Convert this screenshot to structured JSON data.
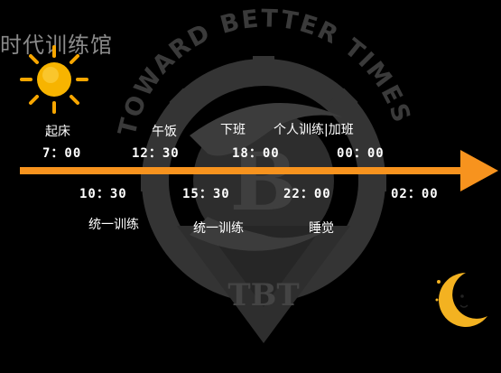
{
  "header": {
    "title": "时代训练馆"
  },
  "logo": {
    "arc_text": "TOWARD BETTER TIMES",
    "monogram": "TBT"
  },
  "colors": {
    "background": "#000000",
    "arrow": "#F7931E",
    "logo_gray": "#3a3a3a",
    "sun": "#F7A600",
    "moon": "#F3B221"
  },
  "icons": {
    "sun": "sun-icon",
    "moon": "crescent-moon-icon"
  },
  "events_above": [
    {
      "label": "起床",
      "time": "7：00"
    },
    {
      "label": "午饭",
      "time": "12：30"
    },
    {
      "label": "下班",
      "time": "18：00"
    },
    {
      "label": "个人训练|加班",
      "time": "00：00"
    }
  ],
  "events_below": [
    {
      "label": "统一训练",
      "time": "10：30"
    },
    {
      "label": "统一训练",
      "time": "15：30"
    },
    {
      "label": "睡觉",
      "time": "22：00"
    },
    {
      "label": "",
      "time": "02：00"
    }
  ]
}
